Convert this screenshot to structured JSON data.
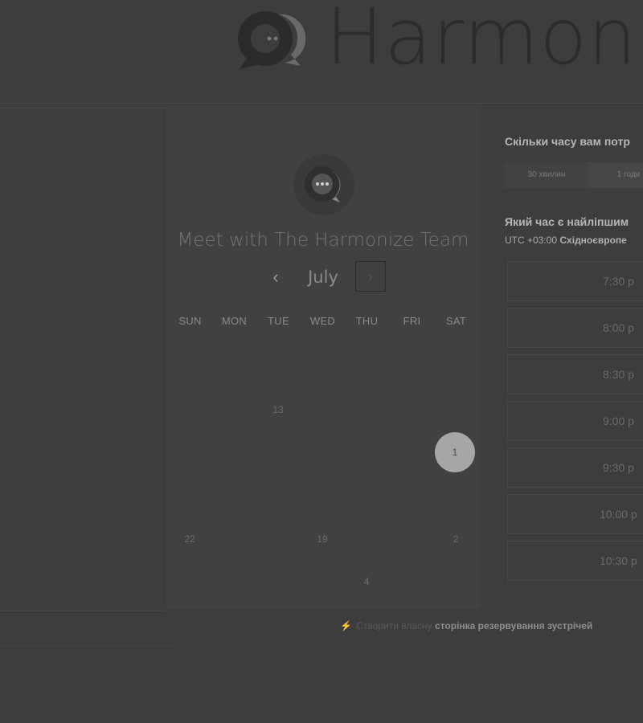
{
  "header": {
    "brand_name": "Harmoni"
  },
  "card": {
    "title": "Meet with The Harmonize Team",
    "month": "July",
    "prev_icon": "‹",
    "next_icon": "›",
    "weekdays": [
      "SUN",
      "MON",
      "TUE",
      "WED",
      "THU",
      "FRI",
      "SAT"
    ],
    "days": [
      "13",
      "1",
      "22",
      "19",
      "2",
      "4"
    ],
    "selected_day": "1"
  },
  "duration": {
    "question": "Скільки часу вам потр",
    "options": [
      "30 хвилин",
      "1 годи"
    ]
  },
  "time": {
    "question": "Який час є найліпшим",
    "tz_offset": "UTC +03:00",
    "tz_name": "Східноєвропе",
    "slots": [
      "7:30 p",
      "8:00 p",
      "8:30 p",
      "9:00 p",
      "9:30 p",
      "10:00 p",
      "10:30 p"
    ]
  },
  "footer": {
    "prefix": "Створити власну",
    "link": "сторінка резервування зустрічей"
  }
}
